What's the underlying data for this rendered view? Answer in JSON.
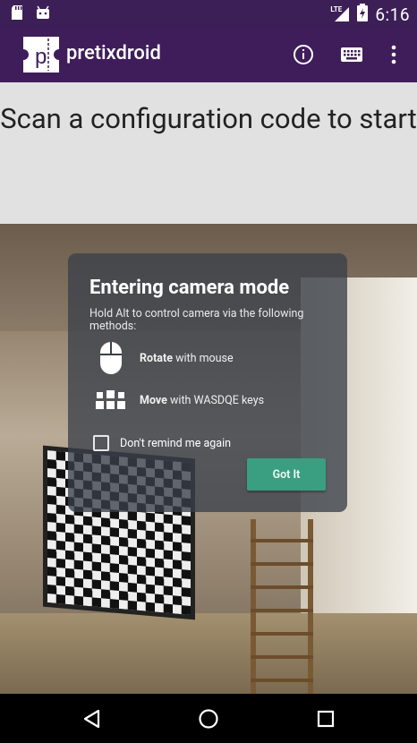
{
  "status_bar": {
    "time": "6:16",
    "network": "LTE"
  },
  "app_bar": {
    "logo_letter": "p",
    "title": "pretixdroid",
    "icons": [
      "info-icon",
      "keyboard-icon",
      "more-vert-icon"
    ]
  },
  "main": {
    "scan_prompt": "Scan a configuration code to start"
  },
  "dialog": {
    "title": "Entering camera mode",
    "subtitle": "Hold Alt to control camera via the following methods:",
    "rows": [
      {
        "action": "Rotate",
        "rest": " with mouse",
        "icon": "mouse-icon"
      },
      {
        "action": "Move",
        "rest": " with WASDQE keys",
        "icon": "keys-icon"
      }
    ],
    "checkbox_label": "Don't remind me again",
    "checkbox_checked": false,
    "button_label": "Got It",
    "colors": {
      "button": "#3a9e80",
      "panel": "#3a404a"
    }
  },
  "nav": {
    "icons": [
      "back-icon",
      "home-icon",
      "recents-icon"
    ]
  },
  "colors": {
    "app_bar": "#3f1d5a",
    "status_bar": "#3d1f57"
  }
}
